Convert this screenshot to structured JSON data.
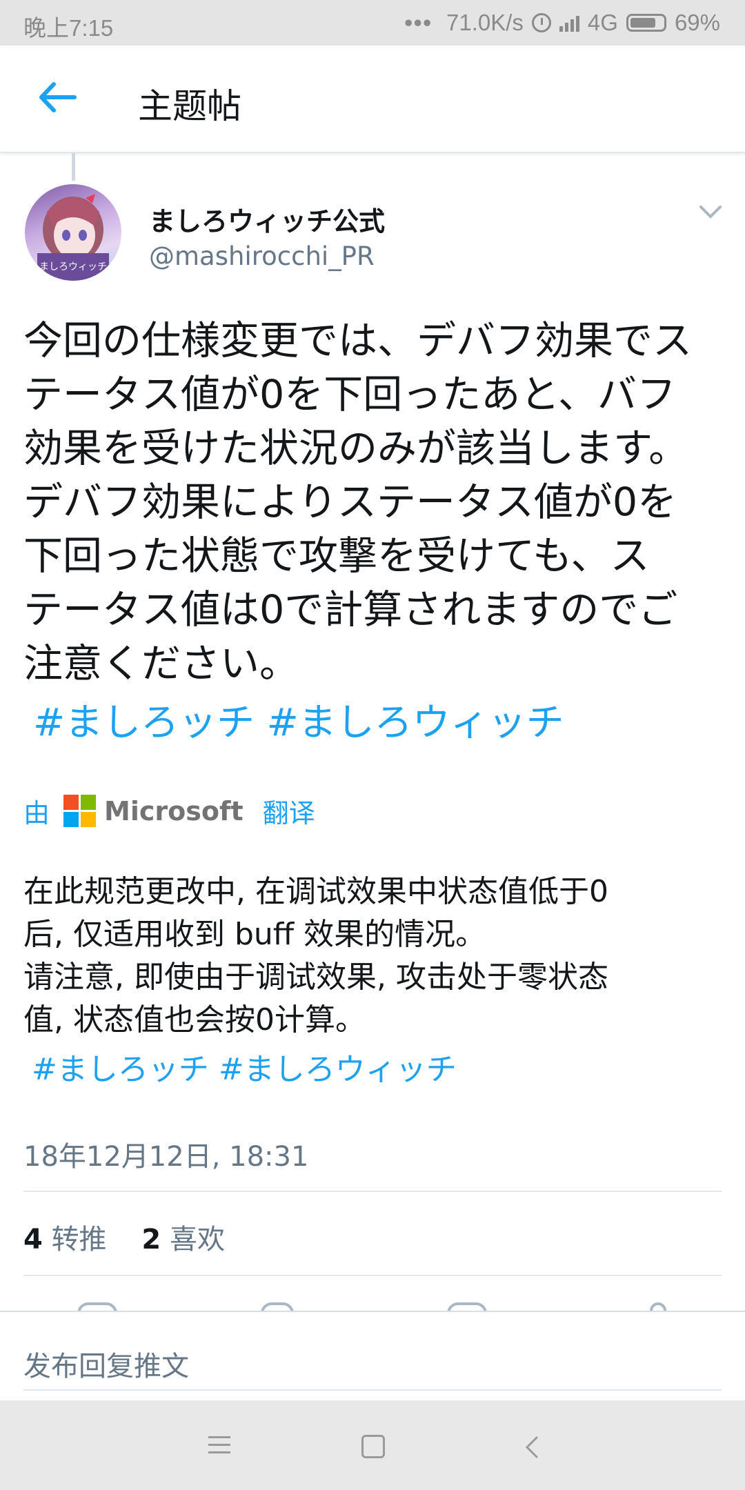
{
  "status_bar": {
    "time": "晚上7:15",
    "dots": "•••",
    "net_speed": "71.0K/s",
    "network": "4G",
    "battery": "69%",
    "battery_level": 0.69
  },
  "header": {
    "title": "主题帖"
  },
  "tweet": {
    "display_name": "ましろウィッチ公式",
    "handle": "@mashirocchi_PR",
    "text_lines": [
      "今回の仕様変更では、デバフ効果でス",
      "テータス値が0を下回ったあと、バフ",
      "効果を受けた状況のみが該当します。",
      "デバフ効果によりステータス値が0を",
      "下回った状態で攻撃を受けても、ス",
      "テータス値は0で計算されますのでご",
      "注意ください。"
    ],
    "hashtags": "#ましろッチ #ましろウィッチ",
    "translation_by": "由",
    "translation_provider": "Microsoft",
    "translate_action": "翻译",
    "translated_lines": [
      "在此规范更改中, 在调试效果中状态值低于0",
      "后, 仅适用收到 buff 效果的情况。",
      "请注意, 即使由于调试效果, 攻击处于零状态",
      "值, 状态值也会按0计算。"
    ],
    "translated_hashtags": "#ましろッチ #ましろウィッチ",
    "timestamp": "18年12月12日, 18:31",
    "retweet_count": "4",
    "retweet_label": "转推",
    "like_count": "2",
    "like_label": "喜欢"
  },
  "reply": {
    "placeholder": "发布回复推文"
  },
  "colors": {
    "accent": "#1da1f2",
    "secondary_text": "#657786",
    "ms_red": "#f25022",
    "ms_green": "#7fba00",
    "ms_blue": "#00a4ef",
    "ms_yellow": "#ffb900"
  }
}
